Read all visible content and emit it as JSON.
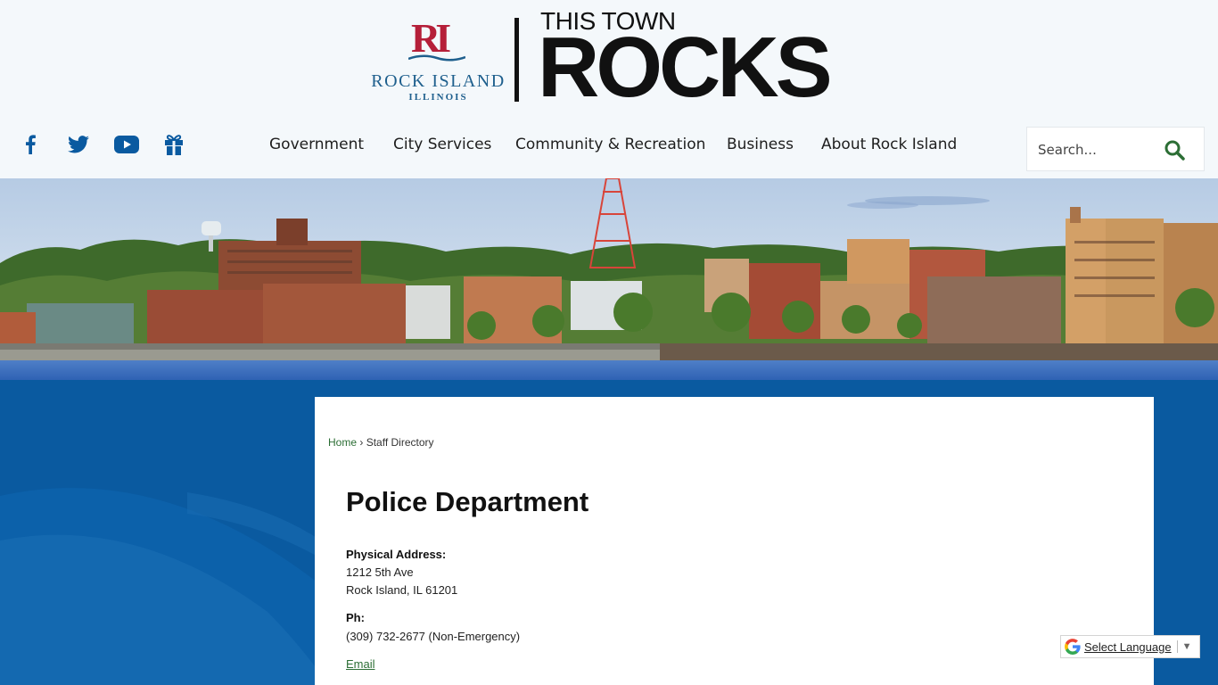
{
  "header": {
    "logo": {
      "mark": "RI",
      "name": "ROCK ISLAND",
      "state": "ILLINOIS"
    },
    "tagline": {
      "top": "THIS TOWN",
      "main": "ROCKS"
    },
    "social": [
      {
        "icon": "facebook-icon",
        "glyph": "f"
      },
      {
        "icon": "twitter-icon"
      },
      {
        "icon": "youtube-icon"
      },
      {
        "icon": "gift-icon"
      }
    ],
    "nav": [
      "Government",
      "City Services",
      "Community & Recreation",
      "Business",
      "About Rock Island"
    ],
    "search": {
      "placeholder": "Search..."
    }
  },
  "breadcrumb": {
    "home": "Home",
    "separator": "›",
    "current": "Staff Directory"
  },
  "department": {
    "title": "Police Department",
    "address_label": "Physical Address:",
    "address_line1": "1212 5th Ave",
    "address_line2": "Rock Island, IL 61201",
    "phone_label": "Ph:",
    "phone": "(309) 732-2677 (Non-Emergency)",
    "email_link": "Email"
  },
  "translate": {
    "label": "Select Language",
    "arrow": "▼"
  },
  "colors": {
    "brand_blue": "#0a5aa0",
    "brand_red": "#b51f39",
    "link_green": "#2c6e35",
    "search_green": "#2c6e35"
  }
}
